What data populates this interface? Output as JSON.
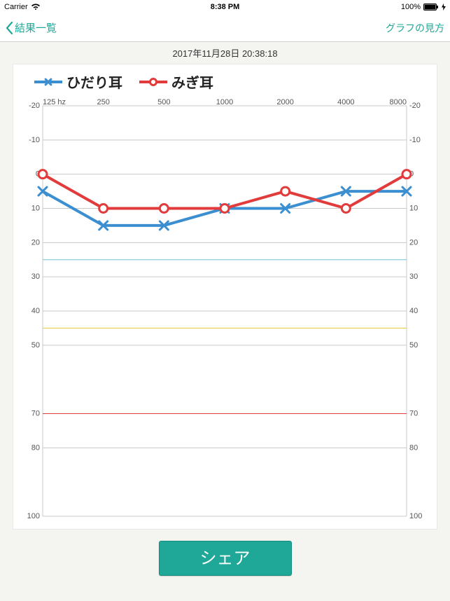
{
  "status": {
    "carrier": "Carrier",
    "wifi_icon": "wifi",
    "time": "8:38 PM",
    "battery": "100%",
    "charging": true
  },
  "nav": {
    "back_label": "結果一覧",
    "right_label": "グラフの見方",
    "title": "2017年11月28日 20:38:18"
  },
  "legend": {
    "left_label": "ひだり耳",
    "right_label": "みぎ耳"
  },
  "share": {
    "label": "シェア"
  },
  "chart_data": {
    "type": "line",
    "title": "",
    "xlabel": "hz",
    "ylabel": "",
    "x_categories": [
      "125 hz",
      "250",
      "500",
      "1000",
      "2000",
      "4000",
      "8000"
    ],
    "ylim": [
      -20,
      100
    ],
    "y_ticks": [
      -20,
      -10,
      0,
      10,
      20,
      30,
      40,
      50,
      70,
      80,
      100
    ],
    "reference_lines": [
      {
        "value": 25,
        "color": "#6fc3d6"
      },
      {
        "value": 45,
        "color": "#e2c83a"
      },
      {
        "value": 70,
        "color": "#e23b3b"
      }
    ],
    "series": [
      {
        "name": "ひだり耳",
        "marker": "x",
        "color": "#3b8fd1",
        "values": [
          5,
          15,
          15,
          10,
          10,
          5,
          5
        ]
      },
      {
        "name": "みぎ耳",
        "marker": "o",
        "color": "#e23b3b",
        "values": [
          0,
          10,
          10,
          10,
          5,
          10,
          0
        ]
      }
    ]
  }
}
